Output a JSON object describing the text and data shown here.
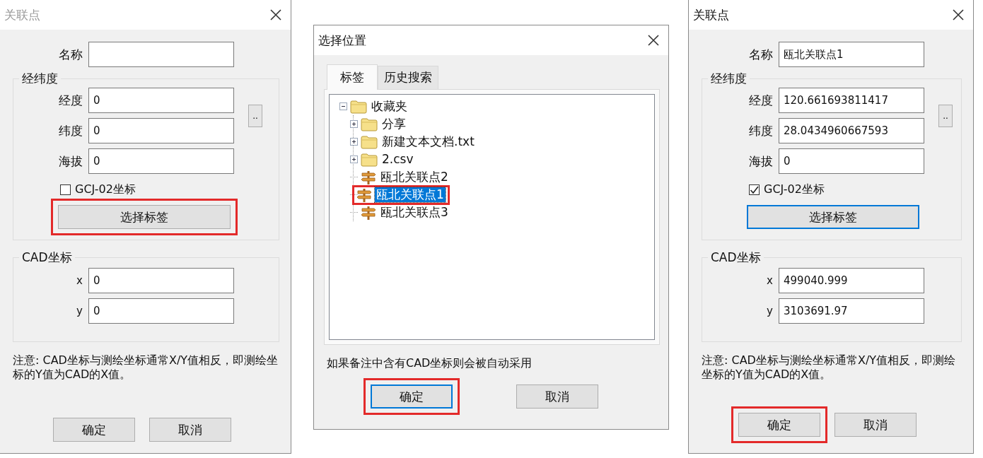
{
  "dialogs": [
    {
      "kind": "point_form",
      "title": "关联点",
      "active": false,
      "name": {
        "label": "名称"
      },
      "lonlat_group": {
        "label": "经纬度",
        "fields": [
          {
            "label": "经度",
            "value": "0"
          },
          {
            "label": "纬度",
            "value": "0"
          },
          {
            "label": "海拔",
            "value": "0"
          }
        ],
        "browse_button": "..",
        "checkbox": {
          "label": "GCJ-02坐标",
          "checked": false
        },
        "select_button": {
          "label": "选择标签",
          "highlighted": true,
          "focused": false
        }
      },
      "cad_group": {
        "label": "CAD坐标",
        "fields": [
          {
            "label": "x",
            "value": "0"
          },
          {
            "label": "y",
            "value": "0"
          }
        ]
      },
      "note": "注意: CAD坐标与测绘坐标通常X/Y值相反，即测绘坐标的Y值为CAD的X值。",
      "buttons": [
        {
          "label": "确定",
          "highlighted": false,
          "focused": false
        },
        {
          "label": "取消",
          "highlighted": false,
          "focused": false
        }
      ]
    },
    {
      "kind": "location_picker",
      "title": "选择位置",
      "active": true,
      "tabs": [
        {
          "label": "标签",
          "selected": true
        },
        {
          "label": "历史搜索",
          "selected": false
        }
      ],
      "tree": [
        {
          "label": "收藏夹",
          "kind": "folder",
          "expanded": true,
          "selected": false,
          "highlighted": false,
          "children": [
            {
              "label": "分享",
              "kind": "folder",
              "expanded": false,
              "selected": false,
              "highlighted": false
            },
            {
              "label": "新建文本文档.txt",
              "kind": "folder",
              "expanded": false,
              "selected": false,
              "highlighted": false
            },
            {
              "label": "2.csv",
              "kind": "folder",
              "expanded": false,
              "selected": false,
              "highlighted": false
            },
            {
              "label": "瓯北关联点2",
              "kind": "point",
              "selected": false,
              "highlighted": false
            },
            {
              "label": "瓯北关联点1",
              "kind": "point",
              "selected": true,
              "highlighted": true
            },
            {
              "label": "瓯北关联点3",
              "kind": "point",
              "selected": false,
              "highlighted": false
            }
          ]
        }
      ],
      "note": "如果备注中含有CAD坐标则会被自动采用",
      "buttons": [
        {
          "label": "确定",
          "highlighted": true,
          "focused": true
        },
        {
          "label": "取消",
          "highlighted": false,
          "focused": false
        }
      ]
    },
    {
      "kind": "point_form",
      "title": "关联点",
      "active": true,
      "name": {
        "label": "名称",
        "value": "瓯北关联点1"
      },
      "lonlat_group": {
        "label": "经纬度",
        "fields": [
          {
            "label": "经度",
            "value": "120.661693811417"
          },
          {
            "label": "纬度",
            "value": "28.0434960667593"
          },
          {
            "label": "海拔",
            "value": "0"
          }
        ],
        "browse_button": "..",
        "checkbox": {
          "label": "GCJ-02坐标",
          "checked": true
        },
        "select_button": {
          "label": "选择标签",
          "highlighted": false,
          "focused": true
        }
      },
      "cad_group": {
        "label": "CAD坐标",
        "fields": [
          {
            "label": "x",
            "value": "499040.999"
          },
          {
            "label": "y",
            "value": "3103691.97"
          }
        ]
      },
      "note": "注意: CAD坐标与测绘坐标通常X/Y值相反，即测绘坐标的Y值为CAD的X值。",
      "buttons": [
        {
          "label": "确定",
          "highlighted": true,
          "focused": false
        },
        {
          "label": "取消",
          "highlighted": false,
          "focused": false
        }
      ]
    }
  ]
}
